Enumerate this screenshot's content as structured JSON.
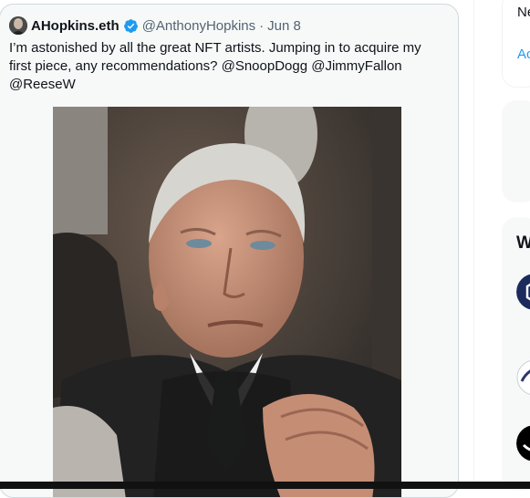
{
  "tweet": {
    "display_name": "AHopkins.eth",
    "handle": "@AnthonyHopkins",
    "separator": "·",
    "date": "Jun 8",
    "text": "I’m astonished by all the great NFT artists. Jumping in to acquire my first piece, any recommendations? @SnoopDogg @JimmyFallon @ReeseW",
    "avatar_icon": "profile-avatar",
    "verified_icon": "verified-badge-icon",
    "colors": {
      "verified": "#1d9bf0",
      "secondary_text": "#536471",
      "link": "#1d9bf0"
    }
  },
  "sidebar": {
    "panel1_text_top": "Ne",
    "panel1_link": "Ac",
    "who_to_follow_heading": "W"
  }
}
